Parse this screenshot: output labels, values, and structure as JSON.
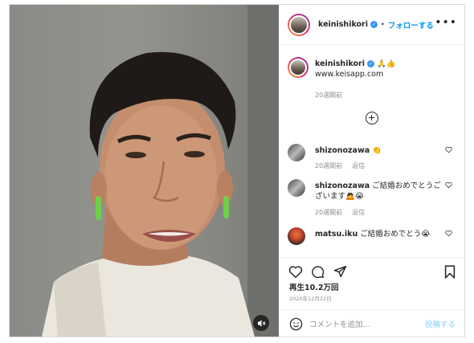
{
  "header": {
    "username": "keinishikori",
    "separator": "•",
    "follow_label": "フォローする",
    "more": "•••"
  },
  "caption": {
    "username": "keinishikori",
    "emoji": "🙏👍",
    "link": "www.keisapp.com",
    "time": "20週間前"
  },
  "comments": [
    {
      "username": "shizonozawa",
      "text": "👏",
      "time": "20週間前",
      "reply": "返信"
    },
    {
      "username": "shizonozawa",
      "text": "ご結婚おめでとうございます🙇😭",
      "time": "20週間前",
      "reply": "返信"
    },
    {
      "username": "matsu.iku",
      "text": "ご結婚おめでとう😭",
      "time": "",
      "reply": ""
    }
  ],
  "stats": {
    "views": "再生10.2万回",
    "date": "2020年12月22日"
  },
  "comment_box": {
    "placeholder": "コメントを追加...",
    "post_label": "投稿する"
  },
  "icons": [
    "emoji-icon",
    "heart-icon",
    "comment-icon",
    "share-icon",
    "bookmark-icon",
    "mute-icon",
    "plus-circle-icon"
  ],
  "colors": {
    "link": "#0095f6",
    "verified": "#3897f0",
    "muted": "#8e8e8e"
  }
}
